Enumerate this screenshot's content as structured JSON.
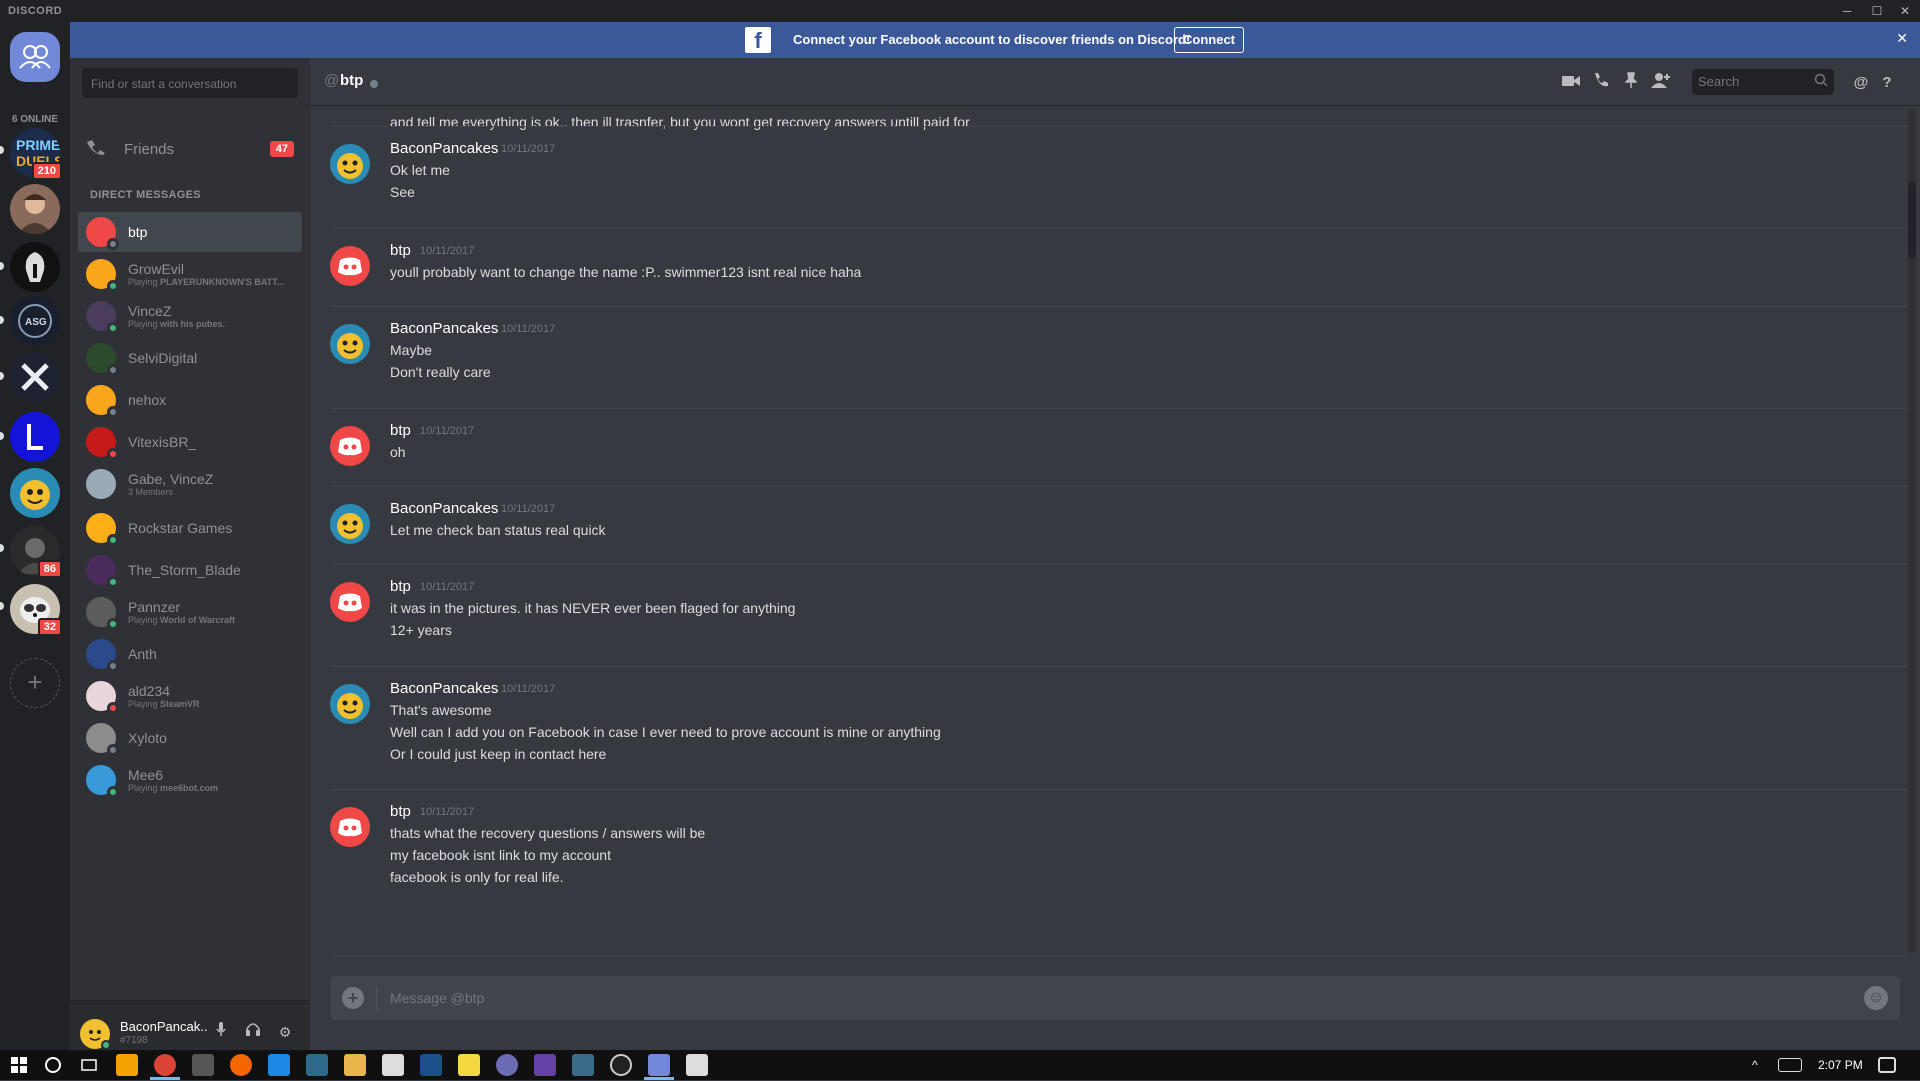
{
  "window": {
    "brand": "DISCORD",
    "min": "─",
    "max": "☐",
    "close": "✕"
  },
  "banner": {
    "message": "Connect your Facebook account to discover friends on Discord!",
    "connect_label": "Connect",
    "fb_glyph": "f",
    "close": "✕"
  },
  "guilds": {
    "online_label": "6 ONLINE",
    "badges": [
      "210",
      "86",
      "32"
    ],
    "add_glyph": "+"
  },
  "dm_sidebar": {
    "search_placeholder": "Find or start a conversation",
    "friends_label": "Friends",
    "friends_badge": "47",
    "section_header": "DIRECT MESSAGES",
    "items": [
      {
        "name": "btp",
        "sub_prefix": "",
        "sub_bold": "",
        "status": "#747f8d",
        "avatar": "#f04747"
      },
      {
        "name": "GrowEvil",
        "sub_prefix": "Playing ",
        "sub_bold": "PLAYERUNKNOWN'S BATT...",
        "status": "#43b581",
        "avatar": "#faa61a"
      },
      {
        "name": "VinceZ",
        "sub_prefix": "Playing ",
        "sub_bold": "with his pubes.",
        "status": "#43b581",
        "avatar": "#4a3c5c"
      },
      {
        "name": "SelviDigital",
        "sub_prefix": "",
        "sub_bold": "",
        "status": "#747f8d",
        "avatar": "#2c4a2c"
      },
      {
        "name": "nehox",
        "sub_prefix": "",
        "sub_bold": "",
        "status": "#747f8d",
        "avatar": "#faa61a"
      },
      {
        "name": "VitexisBR_",
        "sub_prefix": "",
        "sub_bold": "",
        "status": "#f04747",
        "avatar": "#c41a1a"
      },
      {
        "name": "Gabe, VinceZ",
        "sub_prefix": "3 Members",
        "sub_bold": "",
        "status": "",
        "avatar": "#99aab5"
      },
      {
        "name": "Rockstar Games",
        "sub_prefix": "",
        "sub_bold": "",
        "status": "#43b581",
        "avatar": "#fcaf17"
      },
      {
        "name": "The_Storm_Blade",
        "sub_prefix": "",
        "sub_bold": "",
        "status": "#43b581",
        "avatar": "#4b2a5c"
      },
      {
        "name": "Pannzer",
        "sub_prefix": "Playing ",
        "sub_bold": "World of Warcraft",
        "status": "#43b581",
        "avatar": "#5c5c5c"
      },
      {
        "name": "Anth",
        "sub_prefix": "",
        "sub_bold": "",
        "status": "#747f8d",
        "avatar": "#2a4a8c"
      },
      {
        "name": "ald234",
        "sub_prefix": "Playing ",
        "sub_bold": "SteamVR",
        "status": "#f04747",
        "avatar": "#e8d5dc"
      },
      {
        "name": "Xyloto",
        "sub_prefix": "",
        "sub_bold": "",
        "status": "#747f8d",
        "avatar": "#8c8c8c"
      },
      {
        "name": "Mee6",
        "sub_prefix": "Playing ",
        "sub_bold": "mee6bot.com",
        "status": "#43b581",
        "avatar": "#3a9ad9"
      }
    ]
  },
  "user_panel": {
    "name": "BaconPancak..",
    "tag": "#7198",
    "mic": "🎙",
    "headset": "🎧",
    "settings": "⚙"
  },
  "chat_header": {
    "at": "@",
    "channel": "btp",
    "search_placeholder": "Search"
  },
  "messages": {
    "top_partial": "and tell me everything is ok.. then ill trasnfer, but you wont get recovery answers untill paid for",
    "groups": [
      {
        "author": "BaconPancakes",
        "ts": "10/11/2017",
        "av": "bacon",
        "lines": [
          "Ok let me",
          "See"
        ]
      },
      {
        "author": "btp",
        "ts": "10/11/2017",
        "av": "btp",
        "lines": [
          "youll probably want to change the name :P.. swimmer123 isnt real nice haha"
        ]
      },
      {
        "author": "BaconPancakes",
        "ts": "10/11/2017",
        "av": "bacon",
        "lines": [
          "Maybe",
          "Don't really care"
        ]
      },
      {
        "author": "btp",
        "ts": "10/11/2017",
        "av": "btp",
        "lines": [
          "oh"
        ]
      },
      {
        "author": "BaconPancakes",
        "ts": "10/11/2017",
        "av": "bacon",
        "lines": [
          "Let me check ban status real quick"
        ]
      },
      {
        "author": "btp",
        "ts": "10/11/2017",
        "av": "btp",
        "lines": [
          "it was in the pictures. it has NEVER ever been flaged for anything",
          "12+ years"
        ]
      },
      {
        "author": "BaconPancakes",
        "ts": "10/11/2017",
        "av": "bacon",
        "lines": [
          "That's awesome",
          "Well can I add you on Facebook in case I ever need to prove account is mine or anything",
          "Or I could just keep in contact here"
        ]
      },
      {
        "author": "btp",
        "ts": "10/11/2017",
        "av": "btp",
        "lines": [
          "thats what the recovery questions  / answers will be",
          "my facebook isnt link to my account",
          "facebook is only for real life."
        ]
      }
    ]
  },
  "composer": {
    "placeholder": "Message @btp",
    "plus": "+",
    "emoji": "☺"
  },
  "taskbar": {
    "time": "2:07 PM"
  },
  "colors": {
    "bg": "#36393f",
    "sidebar": "#2f3136",
    "guilds": "#202225",
    "banner": "#3b5998",
    "discord_red": "#f04747",
    "online": "#43b581"
  }
}
